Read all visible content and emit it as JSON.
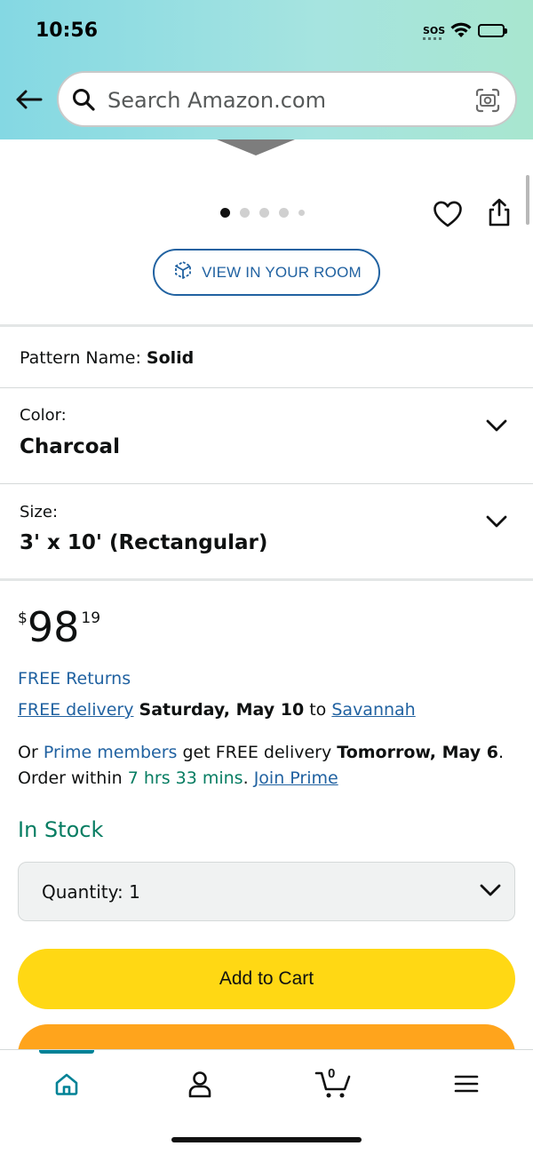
{
  "status_bar": {
    "time": "10:56",
    "sos": "SOS"
  },
  "header": {
    "search_placeholder": "Search Amazon.com"
  },
  "gallery": {
    "dots_count": 5,
    "active_index": 0
  },
  "view_in_room_label": "VIEW IN YOUR ROOM",
  "pattern": {
    "label": "Pattern Name:",
    "value": "Solid"
  },
  "color": {
    "label": "Color:",
    "value": "Charcoal"
  },
  "size": {
    "label": "Size:",
    "value": "3' x 10' (Rectangular)"
  },
  "price": {
    "currency": "$",
    "whole": "98",
    "fraction": "19"
  },
  "returns": "FREE Returns",
  "delivery": {
    "link": "FREE delivery",
    "date": "Saturday, May 10",
    "to": "to",
    "location": "Savannah"
  },
  "prime_offer": {
    "prefix": "Or",
    "prime_members": "Prime members",
    "text": "get FREE delivery",
    "date": "Tomorrow, May 6",
    "period": ".",
    "order_within": "Order within",
    "countdown": "7 hrs 33 mins",
    "dot": ".",
    "join": "Join Prime"
  },
  "stock_status": "In Stock",
  "quantity": {
    "label": "Quantity:",
    "value": "1"
  },
  "add_to_cart_label": "Add to Cart",
  "bottom_nav": {
    "cart_count": "0",
    "active": "home"
  },
  "colors": {
    "accent": "#2162a1",
    "stock_green": "#067d62",
    "add_to_cart": "#ffd814",
    "buy_now": "#ffa41c",
    "nav_active": "#008296"
  }
}
